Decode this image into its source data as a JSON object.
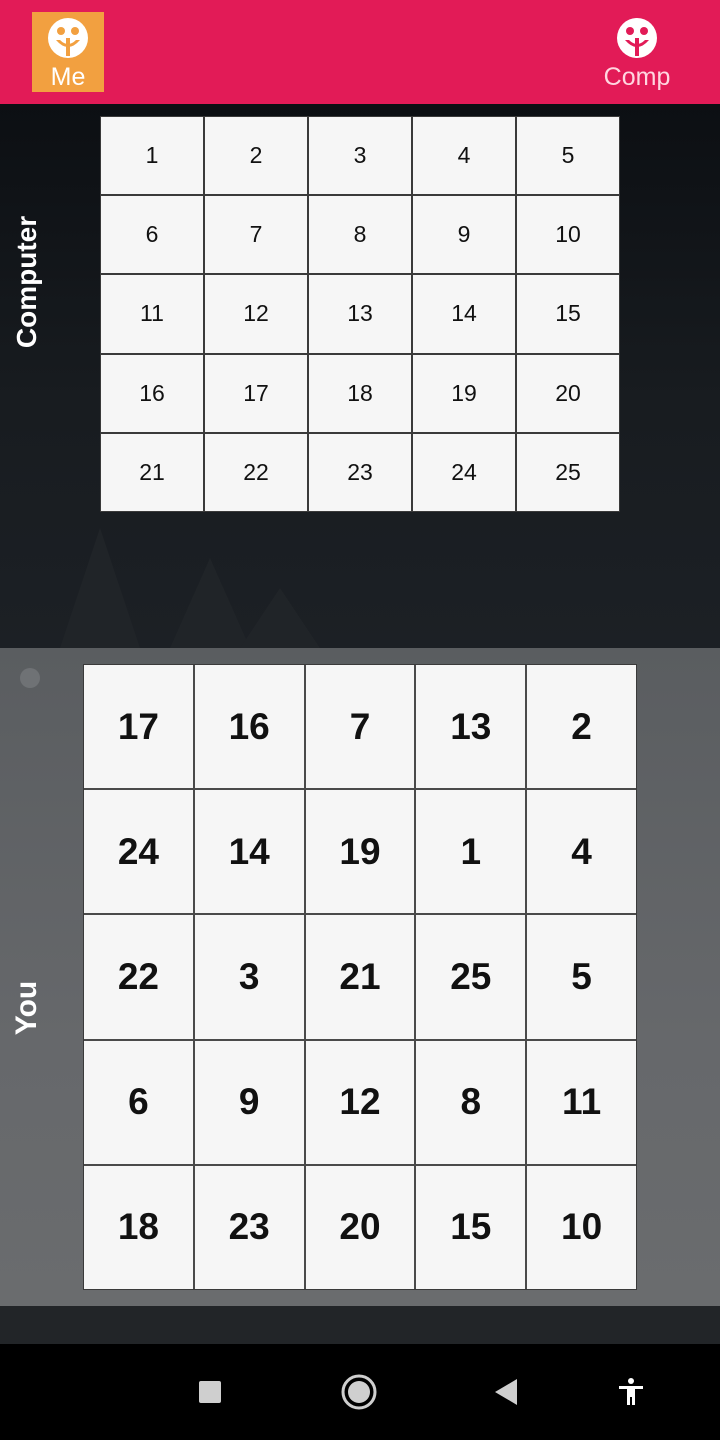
{
  "header": {
    "players": [
      {
        "label": "Me",
        "active": true,
        "icon": "smiley-icon"
      },
      {
        "label": "Comp",
        "active": false,
        "icon": "smiley-icon"
      }
    ],
    "colors": {
      "bar": "#e21b57",
      "active_tab": "#f2a040"
    }
  },
  "computer_board": {
    "label": "Computer",
    "cells": [
      "1",
      "2",
      "3",
      "4",
      "5",
      "6",
      "7",
      "8",
      "9",
      "10",
      "11",
      "12",
      "13",
      "14",
      "15",
      "16",
      "17",
      "18",
      "19",
      "20",
      "21",
      "22",
      "23",
      "24",
      "25"
    ]
  },
  "player_board": {
    "label": "You",
    "cells": [
      "17",
      "16",
      "7",
      "13",
      "2",
      "24",
      "14",
      "19",
      "1",
      "4",
      "22",
      "3",
      "21",
      "25",
      "5",
      "6",
      "9",
      "12",
      "8",
      "11",
      "18",
      "23",
      "20",
      "15",
      "10"
    ]
  },
  "navbar": {
    "buttons": [
      "recent-apps-icon",
      "home-icon",
      "back-icon",
      "accessibility-icon"
    ]
  }
}
